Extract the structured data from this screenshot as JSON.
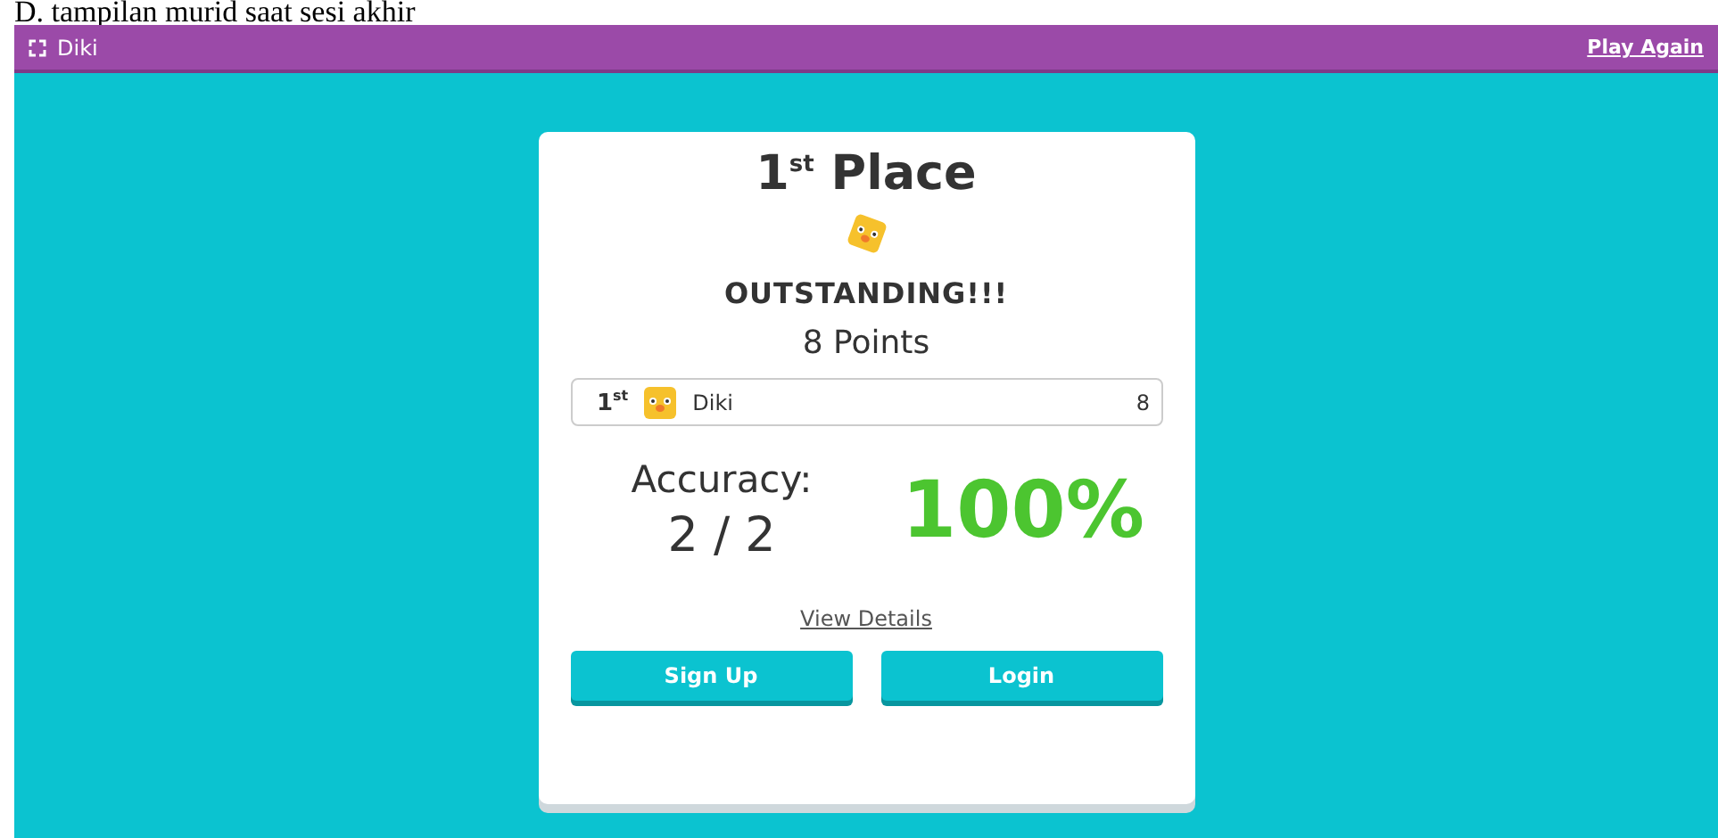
{
  "caption": "D. tampilan murid saat sesi akhir",
  "top_bar": {
    "player_name": "Diki",
    "link": "Play Again"
  },
  "result": {
    "title": "1$^{st}$ Place",
    "message": "OUTSTANDING!!!",
    "points": "8 Points"
  },
  "leaderboard": [
    {
      "rank": "1$^{st}$",
      "name": "Diki",
      "score": "8"
    }
  ],
  "accuracy": {
    "label": "Accuracy:",
    "fraction": "2 / 2",
    "percent": "100%"
  },
  "details_link": "View Details",
  "buttons": [
    {
      "label": "Sign Up"
    },
    {
      "label": "Login"
    }
  ]
}
